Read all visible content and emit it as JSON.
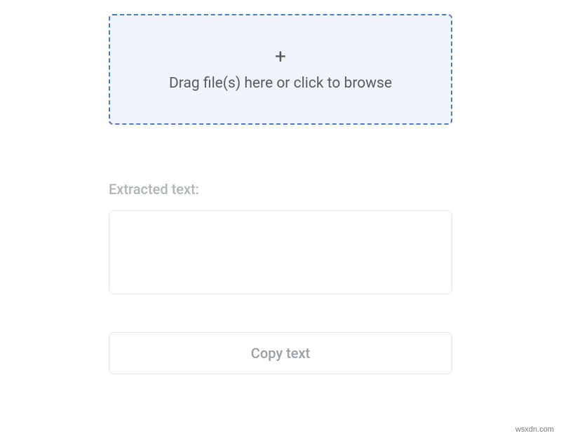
{
  "dropzone": {
    "plus_symbol": "+",
    "instruction": "Drag file(s) here or click to browse"
  },
  "output": {
    "label": "Extracted text:",
    "value": ""
  },
  "actions": {
    "copy_label": "Copy text"
  },
  "watermark": "wsxdn.com"
}
